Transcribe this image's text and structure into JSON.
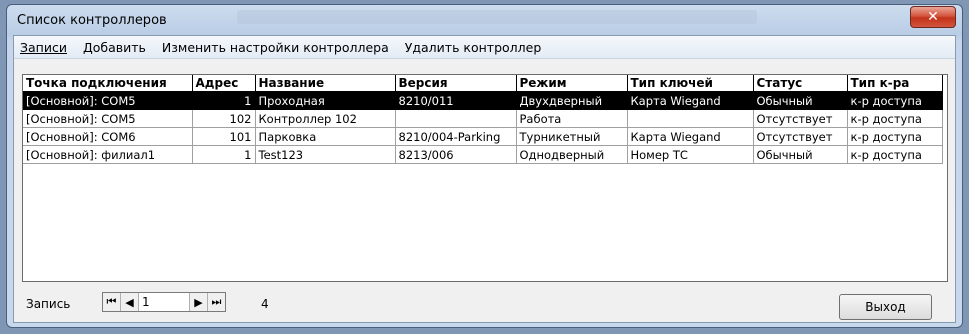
{
  "window": {
    "title": "Список контроллеров",
    "close_glyph": "✕"
  },
  "menu": [
    {
      "label": "Записи"
    },
    {
      "label": "Добавить"
    },
    {
      "label": "Изменить настройки контроллера"
    },
    {
      "label": "Удалить контроллер"
    }
  ],
  "table": {
    "columns": [
      "Точка подключения",
      "Адрес",
      "Название",
      "Версия",
      "Режим",
      "Тип ключей",
      "Статус",
      "Тип к-ра"
    ],
    "rows": [
      [
        "[Основной]: COM5",
        "1",
        "Проходная",
        "8210/011",
        "Двухдверный",
        "Карта Wiegand",
        "Обычный",
        "к-р доступа"
      ],
      [
        "[Основной]: COM5",
        "102",
        "Контроллер 102",
        "",
        "Работа",
        "",
        "Отсутствует",
        "к-р доступа"
      ],
      [
        "[Основной]: COM6",
        "101",
        "Парковка",
        "8210/004-Parking",
        "Турникетный",
        "Карта Wiegand",
        "Отсутствует",
        "к-р доступа"
      ],
      [
        "[Основной]: филиал1",
        "1",
        "Test123",
        "8213/006",
        "Однодверный",
        "Номер ТС",
        "Обычный",
        "к-р доступа"
      ]
    ],
    "selected_row": 0
  },
  "footer": {
    "record_label": "Запись",
    "current_record": "1",
    "total_records": "4",
    "first_glyph": "⏮",
    "prev_glyph": "◀",
    "next_glyph": "▶",
    "last_glyph": "⏭",
    "exit_label": "Выход"
  }
}
